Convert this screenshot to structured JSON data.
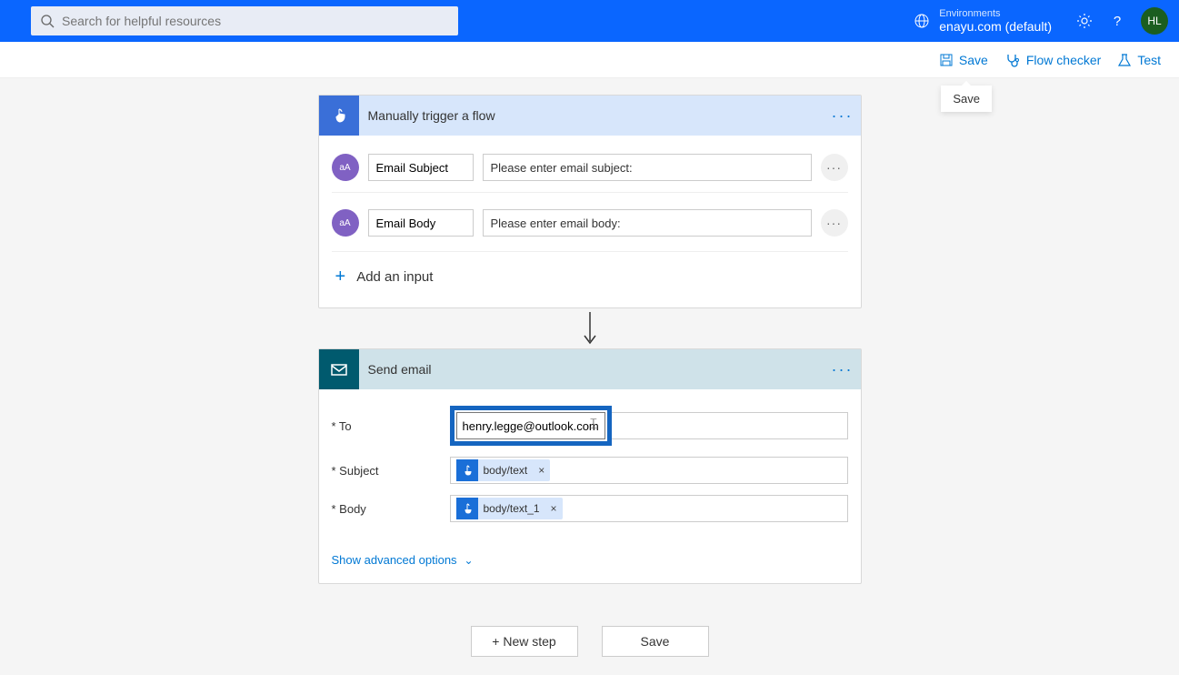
{
  "header": {
    "search_placeholder": "Search for helpful resources",
    "environments_label": "Environments",
    "environment_name": "enayu.com (default)",
    "avatar_initials": "HL"
  },
  "actionbar": {
    "save": "Save",
    "flow_checker": "Flow checker",
    "test": "Test",
    "tooltip": "Save"
  },
  "trigger": {
    "title": "Manually trigger a flow",
    "inputs": [
      {
        "type": "aA",
        "name": "Email Subject",
        "prompt": "Please enter email subject:"
      },
      {
        "type": "aA",
        "name": "Email Body",
        "prompt": "Please enter email body:"
      }
    ],
    "add_input": "Add an input"
  },
  "action": {
    "title": "Send email",
    "fields": {
      "to_label": "* To",
      "to_value": "henry.legge@outlook.com",
      "subject_label": "* Subject",
      "subject_token": "body/text",
      "body_label": "* Body",
      "body_token": "body/text_1"
    },
    "advanced": "Show advanced options"
  },
  "buttons": {
    "new_step": "+ New step",
    "save": "Save"
  }
}
